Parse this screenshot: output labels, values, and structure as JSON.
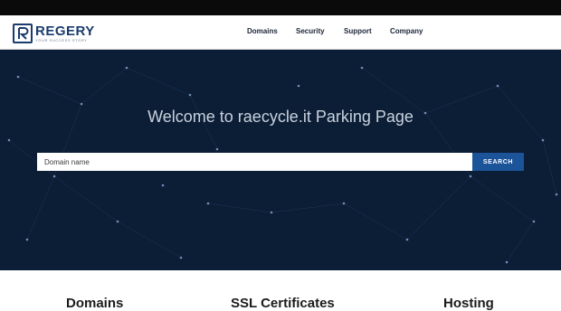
{
  "brand": {
    "name": "REGERY",
    "tagline": "your success story",
    "color": "#1a3c6e"
  },
  "nav": {
    "items": [
      "Domains",
      "Security",
      "Support",
      "Company"
    ]
  },
  "hero": {
    "title": "Welcome to raecycle.it Parking Page",
    "background": "#0c1d36"
  },
  "search": {
    "placeholder": "Domain name",
    "button_label": "SEARCH",
    "button_color": "#1c5499"
  },
  "sections": {
    "titles": [
      "Domains",
      "SSL Certificates",
      "Hosting"
    ]
  }
}
